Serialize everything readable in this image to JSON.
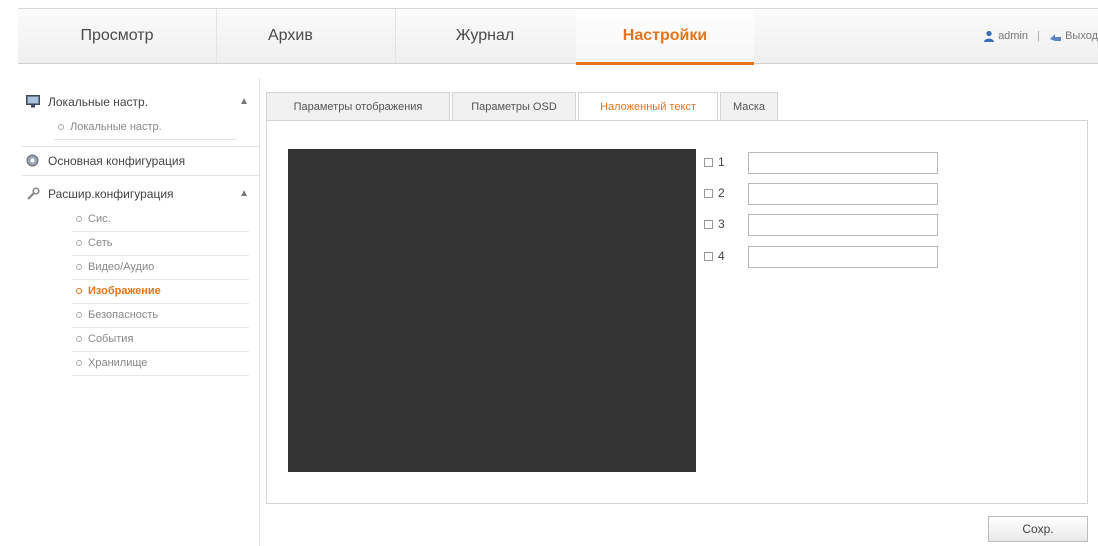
{
  "nav": {
    "tabs": [
      {
        "label": "Просмотр"
      },
      {
        "label": "Архив"
      },
      {
        "label": "Журнал"
      },
      {
        "label": "Настройки",
        "active": true
      }
    ],
    "user": "admin",
    "logout": "Выход"
  },
  "sidebar": {
    "local": {
      "label": "Локальные настр.",
      "icon": "monitor-icon",
      "sub": "Локальные настр."
    },
    "basic": {
      "label": "Основная конфигурация",
      "icon": "gear-icon"
    },
    "advanced": {
      "label": "Расшир.конфигурация",
      "icon": "wrench-icon",
      "items": [
        {
          "label": "Сис."
        },
        {
          "label": "Сеть"
        },
        {
          "label": "Видео/Аудио"
        },
        {
          "label": "Изображение",
          "active": true
        },
        {
          "label": "Безопасность"
        },
        {
          "label": "События"
        },
        {
          "label": "Хранилище"
        }
      ]
    }
  },
  "content": {
    "tabs": [
      {
        "label": "Параметры отображения"
      },
      {
        "label": "Параметры OSD"
      },
      {
        "label": "Наложенный текст",
        "active": true
      },
      {
        "label": "Маска"
      }
    ],
    "overlays": [
      {
        "num": "1",
        "value": ""
      },
      {
        "num": "2",
        "value": ""
      },
      {
        "num": "3",
        "value": ""
      },
      {
        "num": "4",
        "value": ""
      }
    ],
    "save_label": "Сохр."
  },
  "colors": {
    "accent": "#e8731a",
    "preview_bg": "#333333"
  }
}
